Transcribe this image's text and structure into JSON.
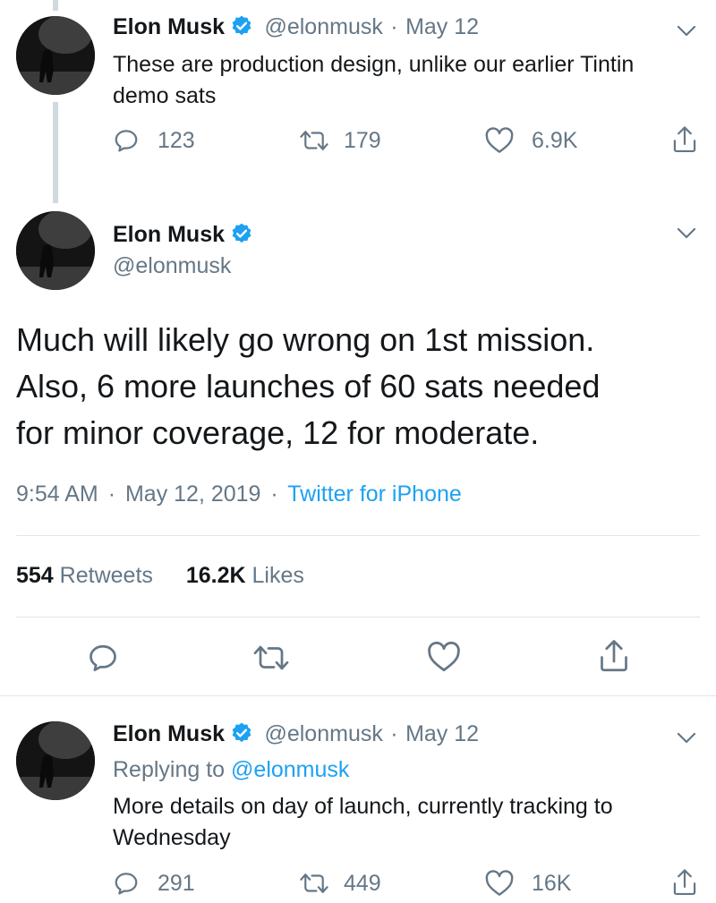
{
  "tweet_prev": {
    "name": "Elon Musk",
    "handle": "@elonmusk",
    "date": "May 12",
    "separator": "·",
    "text_line1": "These are production design, unlike our earlier Tintin",
    "text_line2": "demo sats",
    "replies": "123",
    "retweets": "179",
    "likes": "6.9K"
  },
  "tweet_main": {
    "name": "Elon Musk",
    "handle": "@elonmusk",
    "text_line1": "Much will likely go wrong on 1st mission.",
    "text_line2": "Also, 6 more launches of 60 sats needed",
    "text_line3": "for minor coverage, 12 for moderate.",
    "time": "9:54 AM",
    "date": "May 12, 2019",
    "separator": "·",
    "source": "Twitter for iPhone",
    "retweet_count": "554",
    "retweet_label": "Retweets",
    "like_count": "16.2K",
    "like_label": "Likes"
  },
  "tweet_reply": {
    "name": "Elon Musk",
    "handle": "@elonmusk",
    "date": "May 12",
    "separator": "·",
    "replying_prefix": "Replying to",
    "replying_handle": "@elonmusk",
    "text_line1": "More details on day of launch, currently tracking to",
    "text_line2": "Wednesday",
    "replies": "291",
    "retweets": "449",
    "likes": "16K"
  },
  "colors": {
    "accent": "#1da1f2",
    "secondary_text": "#657786",
    "primary_text": "#14171a",
    "thread_line": "#cfd9de"
  },
  "icons": [
    "verified-badge-icon",
    "chevron-down-icon",
    "reply-icon",
    "retweet-icon",
    "like-icon",
    "share-icon"
  ]
}
